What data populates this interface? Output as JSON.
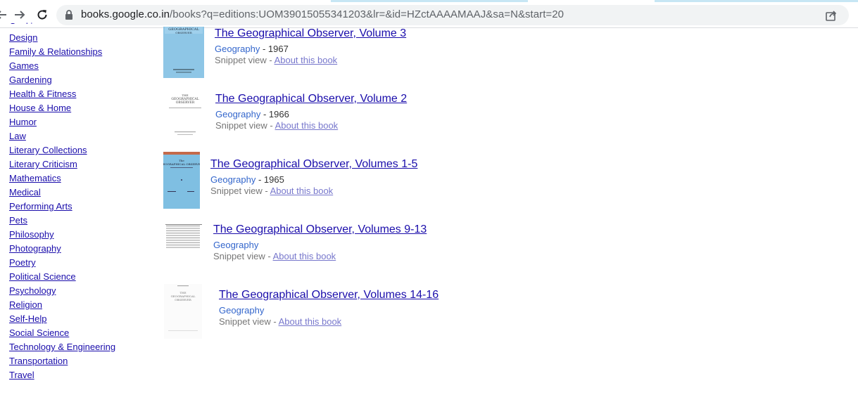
{
  "browser": {
    "url_host": "books.google.co.in",
    "url_rest": "/books?q=editions:UOM39015055341203&lr=&id=HZctAAAAMAAJ&sa=N&start=20"
  },
  "sidebar": {
    "items": [
      {
        "label": "Design"
      },
      {
        "label": "Family & Relationships"
      },
      {
        "label": "Games"
      },
      {
        "label": "Gardening"
      },
      {
        "label": "Health & Fitness"
      },
      {
        "label": "House & Home"
      },
      {
        "label": "Humor"
      },
      {
        "label": "Law"
      },
      {
        "label": "Literary Collections"
      },
      {
        "label": "Literary Criticism"
      },
      {
        "label": "Mathematics"
      },
      {
        "label": "Medical"
      },
      {
        "label": "Performing Arts"
      },
      {
        "label": "Pets"
      },
      {
        "label": "Philosophy"
      },
      {
        "label": "Photography"
      },
      {
        "label": "Poetry"
      },
      {
        "label": "Political Science"
      },
      {
        "label": "Psychology"
      },
      {
        "label": "Religion"
      },
      {
        "label": "Self-Help"
      },
      {
        "label": "Social Science"
      },
      {
        "label": "Technology & Engineering"
      },
      {
        "label": "Transportation"
      },
      {
        "label": "Travel"
      }
    ]
  },
  "results": [
    {
      "title": "The Geographical Observer, Volume 3",
      "category": "Geography",
      "year": "1967",
      "sep": " - ",
      "view": "Snippet view",
      "view_sep": " - ",
      "about": "About this book"
    },
    {
      "title": "The Geographical Observer, Volume 2",
      "category": "Geography",
      "year": "1966",
      "sep": " - ",
      "view": "Snippet view",
      "view_sep": " - ",
      "about": "About this book"
    },
    {
      "title": "The Geographical Observer, Volumes 1-5",
      "category": "Geography",
      "year": "1965",
      "sep": " - ",
      "view": "Snippet view",
      "view_sep": " - ",
      "about": "About this book"
    },
    {
      "title": "The Geographical Observer, Volumes 9-13",
      "category": "Geography",
      "view": "Snippet view",
      "view_sep": " - ",
      "about": "About this book"
    },
    {
      "title": "The Geographical Observer, Volumes 14-16",
      "category": "Geography",
      "view": "Snippet view",
      "view_sep": " - ",
      "about": "About this book"
    }
  ],
  "colors": {
    "link": "#1a0dab",
    "category": "#3366cc",
    "about": "#7777cc",
    "cover_blue": "#8ec6e6"
  }
}
